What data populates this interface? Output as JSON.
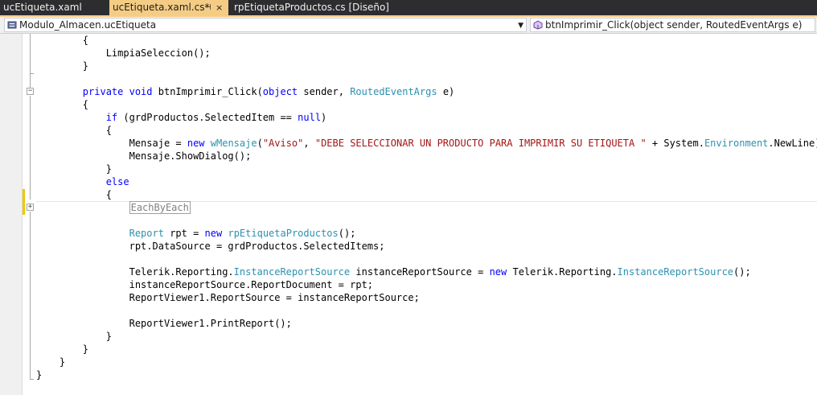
{
  "tabs": [
    {
      "label": "ucEtiqueta.xaml",
      "active": false
    },
    {
      "label": "ucEtiqueta.xaml.cs*",
      "active": true
    },
    {
      "label": "rpEtiquetaProductos.cs [Diseño]",
      "active": false
    }
  ],
  "navbar": {
    "class_selector": "Modulo_Almacen.ucEtiqueta",
    "member_selector": "btnImprimir_Click(object sender, RoutedEventArgs e)"
  },
  "code": {
    "l1": "{",
    "l2": "LimpiaSeleccion();",
    "l3": "}",
    "l4_kw1": "private",
    "l4_kw2": "void",
    "l4_name": "btnImprimir_Click(",
    "l4_kw3": "object",
    "l4_mid": "sender,",
    "l4_type": "RoutedEventArgs",
    "l4_end": "e)",
    "l5": "{",
    "l6_kw": "if",
    "l6_mid": "(grdProductos.SelectedItem ==",
    "l6_null": "null",
    "l6_end": ")",
    "l7": "{",
    "l8_a": "Mensaje =",
    "l8_new": "new",
    "l8_type": "wMensaje",
    "l8_paren": "(",
    "l8_s1": "\"Aviso\"",
    "l8_comma": ",",
    "l8_s2": "\"DEBE SELECCIONAR UN PRODUCTO PARA IMPRIMIR SU ETIQUETA \"",
    "l8_b": "+ System.",
    "l8_env": "Environment",
    "l8_c": ".NewLine);",
    "l9": "Mensaje.ShowDialog();",
    "l10": "}",
    "l11": "else",
    "l12": "{",
    "l13_region": "EachByEach",
    "l14_type": "Report",
    "l14_a": "rpt =",
    "l14_new": "new",
    "l14_type2": "rpEtiquetaProductos",
    "l14_b": "();",
    "l15": "rpt.DataSource = grdProductos.SelectedItems;",
    "l16_a": "Telerik.Reporting.",
    "l16_type": "InstanceReportSource",
    "l16_b": "instanceReportSource =",
    "l16_new": "new",
    "l16_c": "Telerik.Reporting.",
    "l16_type2": "InstanceReportSource",
    "l16_d": "();",
    "l17": "instanceReportSource.ReportDocument = rpt;",
    "l18": "ReportViewer1.ReportSource = instanceReportSource;",
    "l19": "ReportViewer1.PrintReport();",
    "l20": "}",
    "l21": "}",
    "l22": "}",
    "l23": "}"
  },
  "outline_glyphs": {
    "expanded": "−",
    "collapsed": "+"
  },
  "tab_glyphs": {
    "pin": "⊣",
    "close": "×"
  },
  "icons": {
    "class": "class-icon",
    "method": "method-icon",
    "dropdown": "chevron-down-icon"
  },
  "colors": {
    "keyword": "#0000ff",
    "type": "#2b91af",
    "string": "#a31515",
    "active_tab": "#f5cc84",
    "change_mark": "#efc700"
  }
}
